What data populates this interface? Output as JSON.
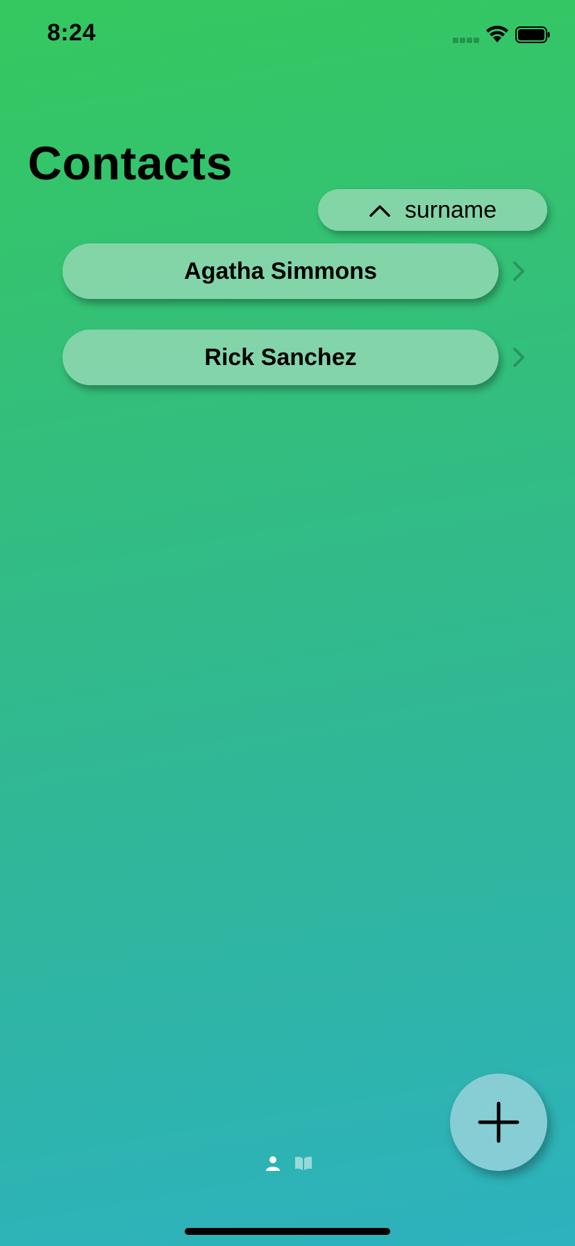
{
  "status_bar": {
    "time": "8:24"
  },
  "header": {
    "title": "Contacts"
  },
  "sort": {
    "label": "surname",
    "direction_icon": "chevron-up-icon"
  },
  "contacts": [
    {
      "name": "Agatha Simmons"
    },
    {
      "name": "Rick Sanchez"
    }
  ],
  "tab_bar": {
    "items": [
      {
        "icon": "person-icon",
        "active": true
      },
      {
        "icon": "book-icon",
        "active": false
      }
    ]
  },
  "add_button": {
    "icon": "plus-icon"
  },
  "colors": {
    "gradient_top": "#35c85f",
    "gradient_bottom": "#2db2bf",
    "pill": "#b4e1c8"
  }
}
